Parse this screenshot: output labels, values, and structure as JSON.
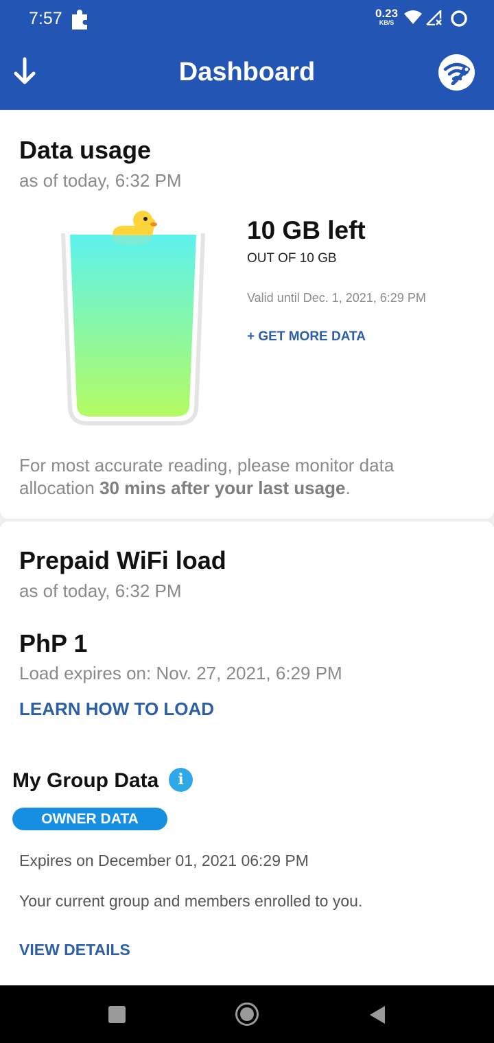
{
  "status_bar": {
    "time": "7:57",
    "net_speed_value": "0.23",
    "net_speed_unit": "KB/S",
    "icons": [
      "puzzle-icon",
      "wifi-icon",
      "signal-icon",
      "sync-icon"
    ]
  },
  "app_bar": {
    "title": "Dashboard",
    "left_icon": "download-arrow-icon",
    "right_icon": "wifi-repair-icon"
  },
  "data_usage": {
    "title": "Data usage",
    "as_of": "as of today, 6:32 PM",
    "left": "10 GB left",
    "total": "OUT OF 10 GB",
    "valid_until": "Valid until Dec. 1, 2021, 6:29 PM",
    "get_more": "+ GET MORE DATA",
    "fill_fraction": 1.0,
    "note_prefix": "For most accurate reading, please monitor data allocation ",
    "note_bold": "30 mins after your last usage",
    "note_suffix": "."
  },
  "prepaid_wifi": {
    "title": "Prepaid WiFi load",
    "as_of": "as of today, 6:32 PM",
    "amount": "PhP 1",
    "expires": "Load expires on: Nov. 27, 2021, 6:29 PM",
    "learn_link": "LEARN HOW TO LOAD"
  },
  "group_data": {
    "title": "My Group Data",
    "info_glyph": "i",
    "badge": "OWNER DATA",
    "expires": "Expires on December 01, 2021 06:29 PM",
    "description": "Your current group and members enrolled to you.",
    "view_details": "VIEW DETAILS"
  },
  "colors": {
    "header": "#2355b4",
    "link": "#2d5fa6",
    "badge": "#168fe2",
    "water_top": "#5cf2ee",
    "water_bottom": "#b4fb63",
    "duck": "#ffd43b"
  }
}
